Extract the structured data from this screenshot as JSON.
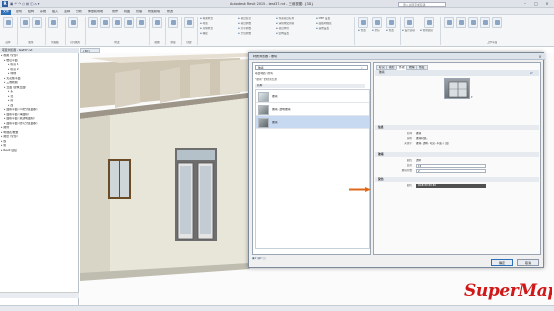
{
  "window": {
    "title": "Autodesk Revit 2015 - test37.rvt - 三维视图: {3D}",
    "search_placeholder": "键入关键字或短语"
  },
  "menu_tabs": [
    "文件",
    "建筑",
    "结构",
    "系统",
    "插入",
    "注释",
    "分析",
    "体量和场地",
    "协作",
    "视图",
    "管理",
    "附加模块",
    "修改"
  ],
  "ribbon": {
    "groups": [
      "选择",
      "属性",
      "剪贴板",
      "几何图形",
      "修改",
      "视图",
      "测量",
      "创建",
      "工作平面"
    ],
    "small_items": [
      "填充样式",
      "材质",
      "对象样式",
      "捕捉",
      "项目信息",
      "项目参数",
      "共享参数",
      "全局参数",
      "传递项目标准",
      "清除未使用项",
      "项目单位",
      "结构设置",
      "MEP 设置",
      "面板明细表",
      "其他设置",
      "位置",
      "坐标",
      "位置",
      "设计选项",
      "管理链接"
    ]
  },
  "project_browser": {
    "title": "项目浏览器 - test37.rvt",
    "items": [
      "视图 (全部)",
      "楼层平面",
      "标高 1",
      "标高 2",
      "场地",
      "天花板平面",
      "三维视图",
      "立面 (建筑立面)",
      "东",
      "北",
      "南",
      "西",
      "面积平面 (人防分区面积)",
      "面积平面 (净面积)",
      "面积平面 (总建筑面积)",
      "面积平面 (防火分区面积)",
      "图例",
      "明细表/数量",
      "图纸 (全部)",
      "族",
      "组",
      "Revit 链接"
    ]
  },
  "view_tab": "{3D}",
  "dialog": {
    "title": "材质浏览器 - 玻璃",
    "search_value": "玻璃",
    "project_materials_label": "项目材质: 所有",
    "filter_hint": "\"玻璃\" 的搜索结果",
    "list_header": "名称",
    "materials": [
      {
        "name": "玻璃",
        "selected": false
      },
      {
        "name": "玻璃, 透明玻璃",
        "selected": false
      },
      {
        "name": "玻璃",
        "selected": true
      }
    ],
    "tabs": [
      "标识",
      "图形",
      "外观",
      "物理",
      "热度"
    ],
    "active_tab": "外观",
    "asset_name": "玻璃",
    "info_section": "信息",
    "info_rows": [
      {
        "label": "名称",
        "value": "玻璃"
      },
      {
        "label": "说明",
        "value": "玻璃材质。"
      },
      {
        "label": "关键字",
        "value": "玻璃, 透明, 可见, 平面, 门窗"
      }
    ],
    "glazing_section": "玻璃",
    "glazing_rows": [
      {
        "label": "颜色",
        "value": "透明"
      },
      {
        "label": "反射",
        "value": "15"
      },
      {
        "label": "玻璃片数",
        "value": "2"
      }
    ],
    "tint_section": "染色",
    "tint_rows": [
      {
        "label": "颜色",
        "value": "RGB 80 80 80"
      }
    ],
    "ok_label": "确定",
    "cancel_label": "取消"
  },
  "logo": "SuperMap"
}
